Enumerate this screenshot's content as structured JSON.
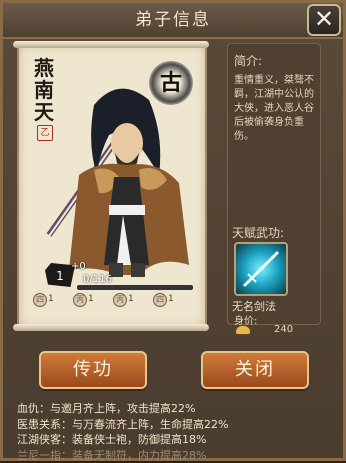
{
  "header": {
    "title": "弟子信息",
    "close_label": "✕"
  },
  "hero": {
    "name": "燕南天",
    "seal": "乙",
    "emblem": "古",
    "level": "1",
    "level_plus": "+0",
    "exp": "0/116",
    "slots": [
      {
        "icon": "四",
        "value": "1"
      },
      {
        "icon": "丙",
        "value": "1"
      },
      {
        "icon": "丙",
        "value": "1"
      },
      {
        "icon": "四",
        "value": "1"
      }
    ]
  },
  "info": {
    "intro_title": "简介:",
    "intro_text": "重情重义，桀骜不羁，江湖中公认的大侠，进入恶人谷后被偷袭身负重伤。",
    "talent_title": "天赋武功:",
    "skill_name": "无名剑法",
    "value_label": "身价:",
    "value": "240"
  },
  "buttons": {
    "pass": "传功",
    "close": "关闭"
  },
  "bonuses": [
    "血仇：与邀月齐上阵，攻击提高22%",
    "医患关系：与万春流齐上阵，生命提高22%",
    "江湖侠客：装备侠士袍，防御提高18%",
    "兰尼一指：装备无制符，内力提高28%"
  ],
  "colors": {
    "accent": "#c0652a",
    "panel": "#4f4032",
    "scroll": "#efe6cf"
  }
}
